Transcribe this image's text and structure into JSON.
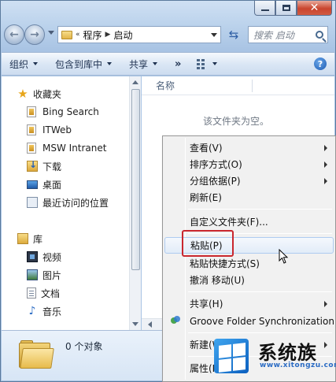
{
  "address": {
    "overflow": "«",
    "crumbs": [
      "程序",
      "启动"
    ]
  },
  "search": {
    "placeholder": "搜索 启动"
  },
  "toolbar": {
    "organize": "组织",
    "include_in_library": "包含到库中",
    "share": "共享",
    "more": "»"
  },
  "sidebar": {
    "favorites": "收藏夹",
    "items": [
      "Bing Search",
      "ITWeb",
      "MSW Intranet",
      "下载",
      "桌面",
      "最近访问的位置"
    ],
    "libraries": "库",
    "lib_items": [
      "视频",
      "图片",
      "文档",
      "音乐"
    ]
  },
  "content": {
    "column_name": "名称",
    "empty_message": "该文件夹为空。"
  },
  "details": {
    "object_count": "0 个对象"
  },
  "context_menu": {
    "view": "查看(V)",
    "sort_by": "排序方式(O)",
    "group_by": "分组依据(P)",
    "refresh": "刷新(E)",
    "customize": "自定义文件夹(F)...",
    "paste": "粘贴(P)",
    "paste_shortcut": "粘贴快捷方式(S)",
    "undo_move": "撤消 移动(U)",
    "share": "共享(H)",
    "groove": "Groove Folder Synchronization",
    "new": "新建(W)",
    "properties": "属性(R)"
  },
  "watermark": {
    "brand": "系统族",
    "url": "www.xitongzu.com"
  },
  "colors": {
    "highlight_border": "#c9272e",
    "menu_hover": "#aecbf0",
    "chrome": "#c7d9ee"
  }
}
